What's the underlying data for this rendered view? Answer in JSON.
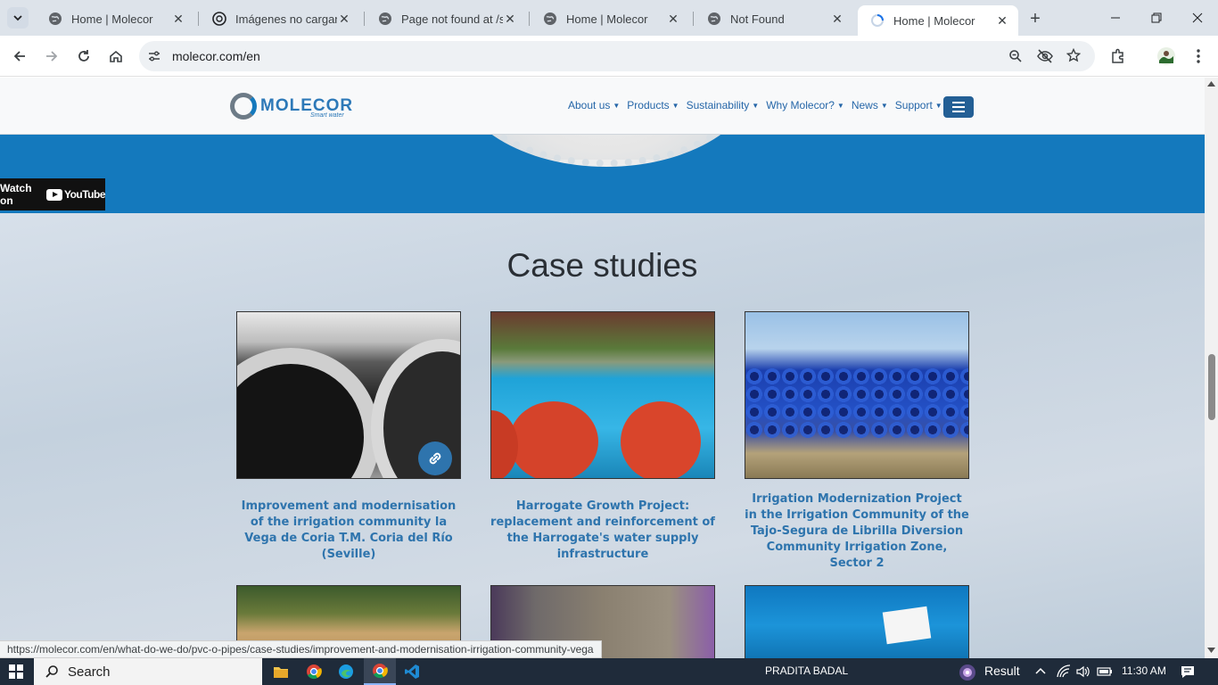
{
  "tabs": [
    {
      "title": "Home | Molecor",
      "active": false
    },
    {
      "title": "Imágenes no cargan | ",
      "active": false
    },
    {
      "title": "Page not found at /st",
      "active": false
    },
    {
      "title": "Home | Molecor",
      "active": false
    },
    {
      "title": "Not Found",
      "active": false
    },
    {
      "title": "Home | Molecor",
      "active": true
    }
  ],
  "address": {
    "url": "molecor.com/en"
  },
  "site": {
    "logo_text": "MOLECOR",
    "logo_tagline": "Smart water",
    "nav": [
      "About us",
      "Products",
      "Sustainability",
      "Why Molecor?",
      "News",
      "Support"
    ]
  },
  "youtube": {
    "label": "Watch on",
    "brand": "YouTube"
  },
  "section": {
    "title": "Case studies",
    "cards": [
      {
        "caption": "Improvement and modernisation of the irrigation community la Vega de Coria T.M. Coria del Río (Seville)"
      },
      {
        "caption": "Harrogate Growth Project: replacement and reinforcement of the Harrogate's water supply infrastructure"
      },
      {
        "caption": "Irrigation Modernization Project in the Irrigation Community of the Tajo-Segura de Librilla Diversion Community Irrigation Zone, Sector 2"
      }
    ]
  },
  "status_bar": {
    "url": "https://molecor.com/en/what-do-we-do/pvc-o-pipes/case-studies/improvement-and-modernisation-irrigation-community-vega"
  },
  "taskbar": {
    "search_placeholder": "Search",
    "user": "PRADITA BADAL",
    "widget": "Result",
    "time": "11:30 AM"
  },
  "colors": {
    "brand_blue": "#1479bd",
    "link_blue": "#2e74ad",
    "nav_blue": "#2566a8"
  }
}
